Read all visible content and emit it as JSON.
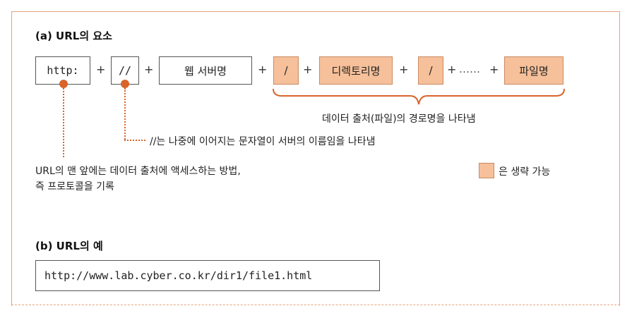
{
  "section_a": {
    "title": "(a) URL의 요소",
    "parts": {
      "scheme": "http:",
      "slashes": "//",
      "server": "웹 서버명",
      "slash1": "/",
      "directory": "디렉토리명",
      "slash2": "/",
      "ellipsis": "……",
      "file": "파일명"
    },
    "plus": "+",
    "brace_label": "데이터 출처(파일)의 경로명을 나타냄",
    "slashes_note": "//는 나중에 이어지는 문자열이 서버의 이름임을 나타냄",
    "scheme_note_line1": "URL의 맨 앞에는 데이터 출처에 액세스하는 방법,",
    "scheme_note_line2": "즉 프로토콜을 기록",
    "legend": "은 생략 가능"
  },
  "section_b": {
    "title": "(b) URL의 예",
    "example": "http://www.lab.cyber.co.kr/dir1/file1.html"
  },
  "colors": {
    "accent": "#d9642a",
    "optional_fill": "#f6c09a",
    "frame": "#e2a37e"
  }
}
